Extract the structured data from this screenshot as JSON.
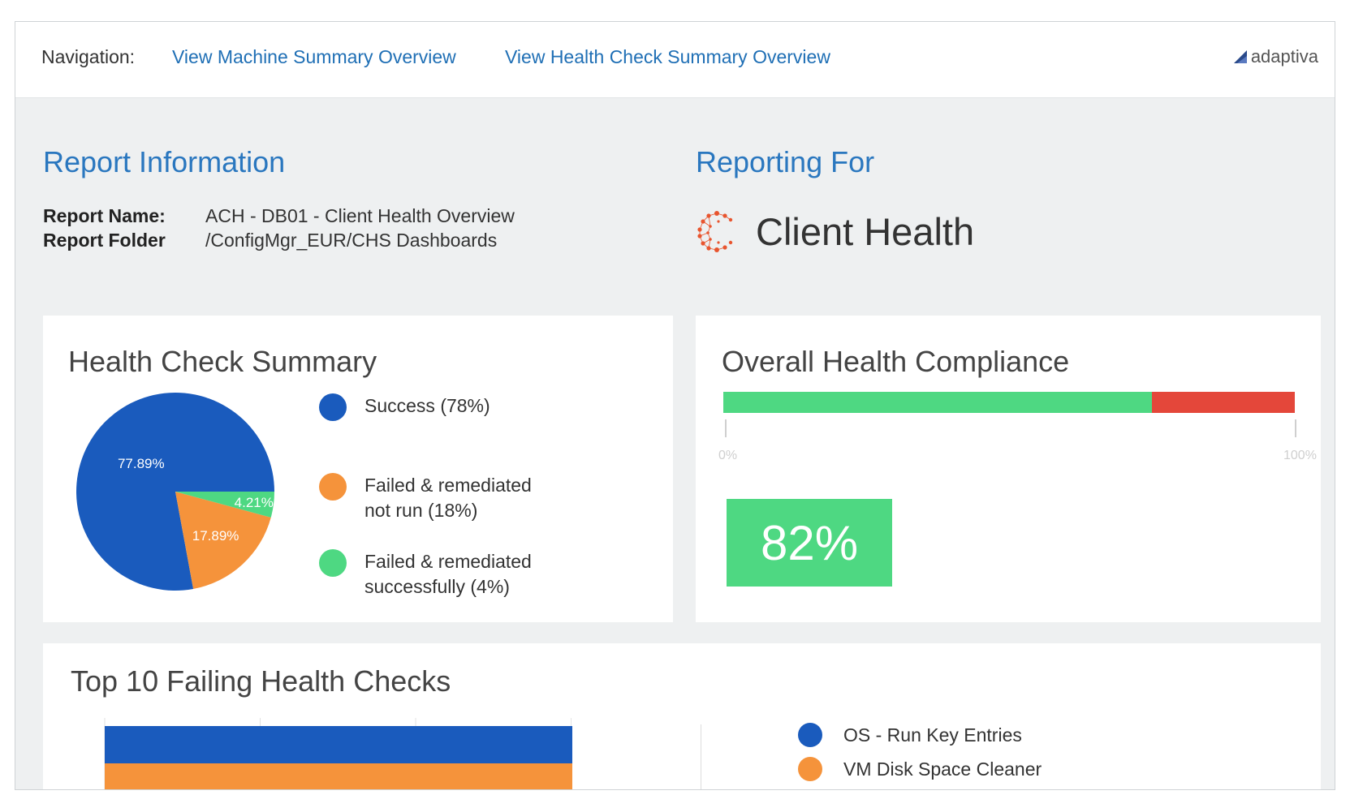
{
  "nav": {
    "label": "Navigation:",
    "links": [
      "View Machine Summary Overview",
      "View Health Check Summary Overview"
    ],
    "brand": "adaptiva"
  },
  "report_info": {
    "heading": "Report Information",
    "name_label": "Report Name:",
    "name_value": "ACH - DB01 - Client Health Overview",
    "folder_label": "Report Folder",
    "folder_value": "/ConfigMgr_EUR/CHS Dashboards"
  },
  "reporting_for": {
    "heading": "Reporting For",
    "value": "Client Health",
    "icon": "client-health-logo-icon"
  },
  "colors": {
    "accent": "#2a77bf",
    "success": "#1a5bbd",
    "not_run": "#f5933b",
    "remediated": "#4ed882",
    "fail": "#e4473a"
  },
  "health_check_summary": {
    "title": "Health Check Summary",
    "legend": [
      "Success (78%)",
      "Failed & remediated not run (18%)",
      "Failed & remediated successfully (4%)"
    ]
  },
  "overall_compliance": {
    "title": "Overall Health Compliance",
    "value_label": "82%",
    "fraction": 0.75,
    "scale_min": "0%",
    "scale_max": "100%"
  },
  "top10": {
    "title": "Top 10 Failing Health Checks",
    "legend": [
      "OS - Run Key Entries",
      "VM Disk Space Cleaner"
    ]
  },
  "chart_data": [
    {
      "type": "pie",
      "title": "Health Check Summary",
      "slices": [
        {
          "label": "Success (78%)",
          "value": 77.89,
          "data_label": "77.89%",
          "color": "#1a5bbd"
        },
        {
          "label": "Failed & remediated not run (18%)",
          "value": 17.89,
          "data_label": "17.89%",
          "color": "#f5933b"
        },
        {
          "label": "Failed & remediated successfully (4%)",
          "value": 4.21,
          "data_label": "4.21%",
          "color": "#4ed882"
        }
      ]
    },
    {
      "type": "bar",
      "title": "Top 10 Failing Health Checks",
      "categories": [
        "OS - Run Key Entries",
        "VM Disk Space Cleaner"
      ],
      "values": [
        100,
        100
      ],
      "colors": [
        "#1a5bbd",
        "#f5933b"
      ]
    }
  ]
}
